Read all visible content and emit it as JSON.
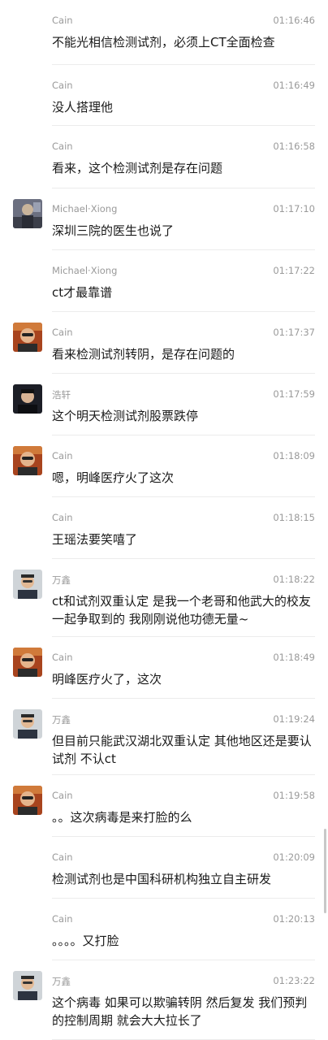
{
  "messages": [
    {
      "name": "Cain",
      "time": "01:16:46",
      "text": "不能光相信检测试剂，必须上CT全面检查",
      "avatar": false
    },
    {
      "name": "Cain",
      "time": "01:16:49",
      "text": "没人搭理他",
      "avatar": false
    },
    {
      "name": "Cain",
      "time": "01:16:58",
      "text": "看来，这个检测试剂是存在问题",
      "avatar": false
    },
    {
      "name": "Michael·Xiong",
      "time": "01:17:10",
      "text": "深圳三院的医生也说了",
      "avatar": "michael"
    },
    {
      "name": "Michael·Xiong",
      "time": "01:17:22",
      "text": "ct才最靠谱",
      "avatar": false
    },
    {
      "name": "Cain",
      "time": "01:17:37",
      "text": "看来检测试剂转阴，是存在问题的",
      "avatar": "cain"
    },
    {
      "name": "浩轩",
      "time": "01:17:59",
      "text": "这个明天检测试剂股票跌停",
      "avatar": "haoxuan"
    },
    {
      "name": "Cain",
      "time": "01:18:09",
      "text": "嗯，明峰医疗火了这次",
      "avatar": "cain"
    },
    {
      "name": "Cain",
      "time": "01:18:15",
      "text": "王瑶法要笑嘻了",
      "avatar": false
    },
    {
      "name": "万鑫",
      "time": "01:18:22",
      "text": "ct和试剂双重认定 是我一个老哥和他武大的校友 一起争取到的 我刚刚说他功德无量~",
      "avatar": "wanxin"
    },
    {
      "name": "Cain",
      "time": "01:18:49",
      "text": "明峰医疗火了，这次",
      "avatar": "cain"
    },
    {
      "name": "万鑫",
      "time": "01:19:24",
      "text": "但目前只能武汉湖北双重认定 其他地区还是要认试剂 不认ct",
      "avatar": "wanxin"
    },
    {
      "name": "Cain",
      "time": "01:19:58",
      "text": "。。这次病毒是来打脸的么",
      "avatar": "cain"
    },
    {
      "name": "Cain",
      "time": "01:20:09",
      "text": "检测试剂也是中国科研机构独立自主研发",
      "avatar": false
    },
    {
      "name": "Cain",
      "time": "01:20:13",
      "text": "。。。。又打脸",
      "avatar": false
    },
    {
      "name": "万鑫",
      "time": "01:23:22",
      "text": "这个病毒 如果可以欺骗转阴 然后复发 我们预判的控制周期 就会大大拉长了",
      "avatar": "wanxin"
    }
  ]
}
